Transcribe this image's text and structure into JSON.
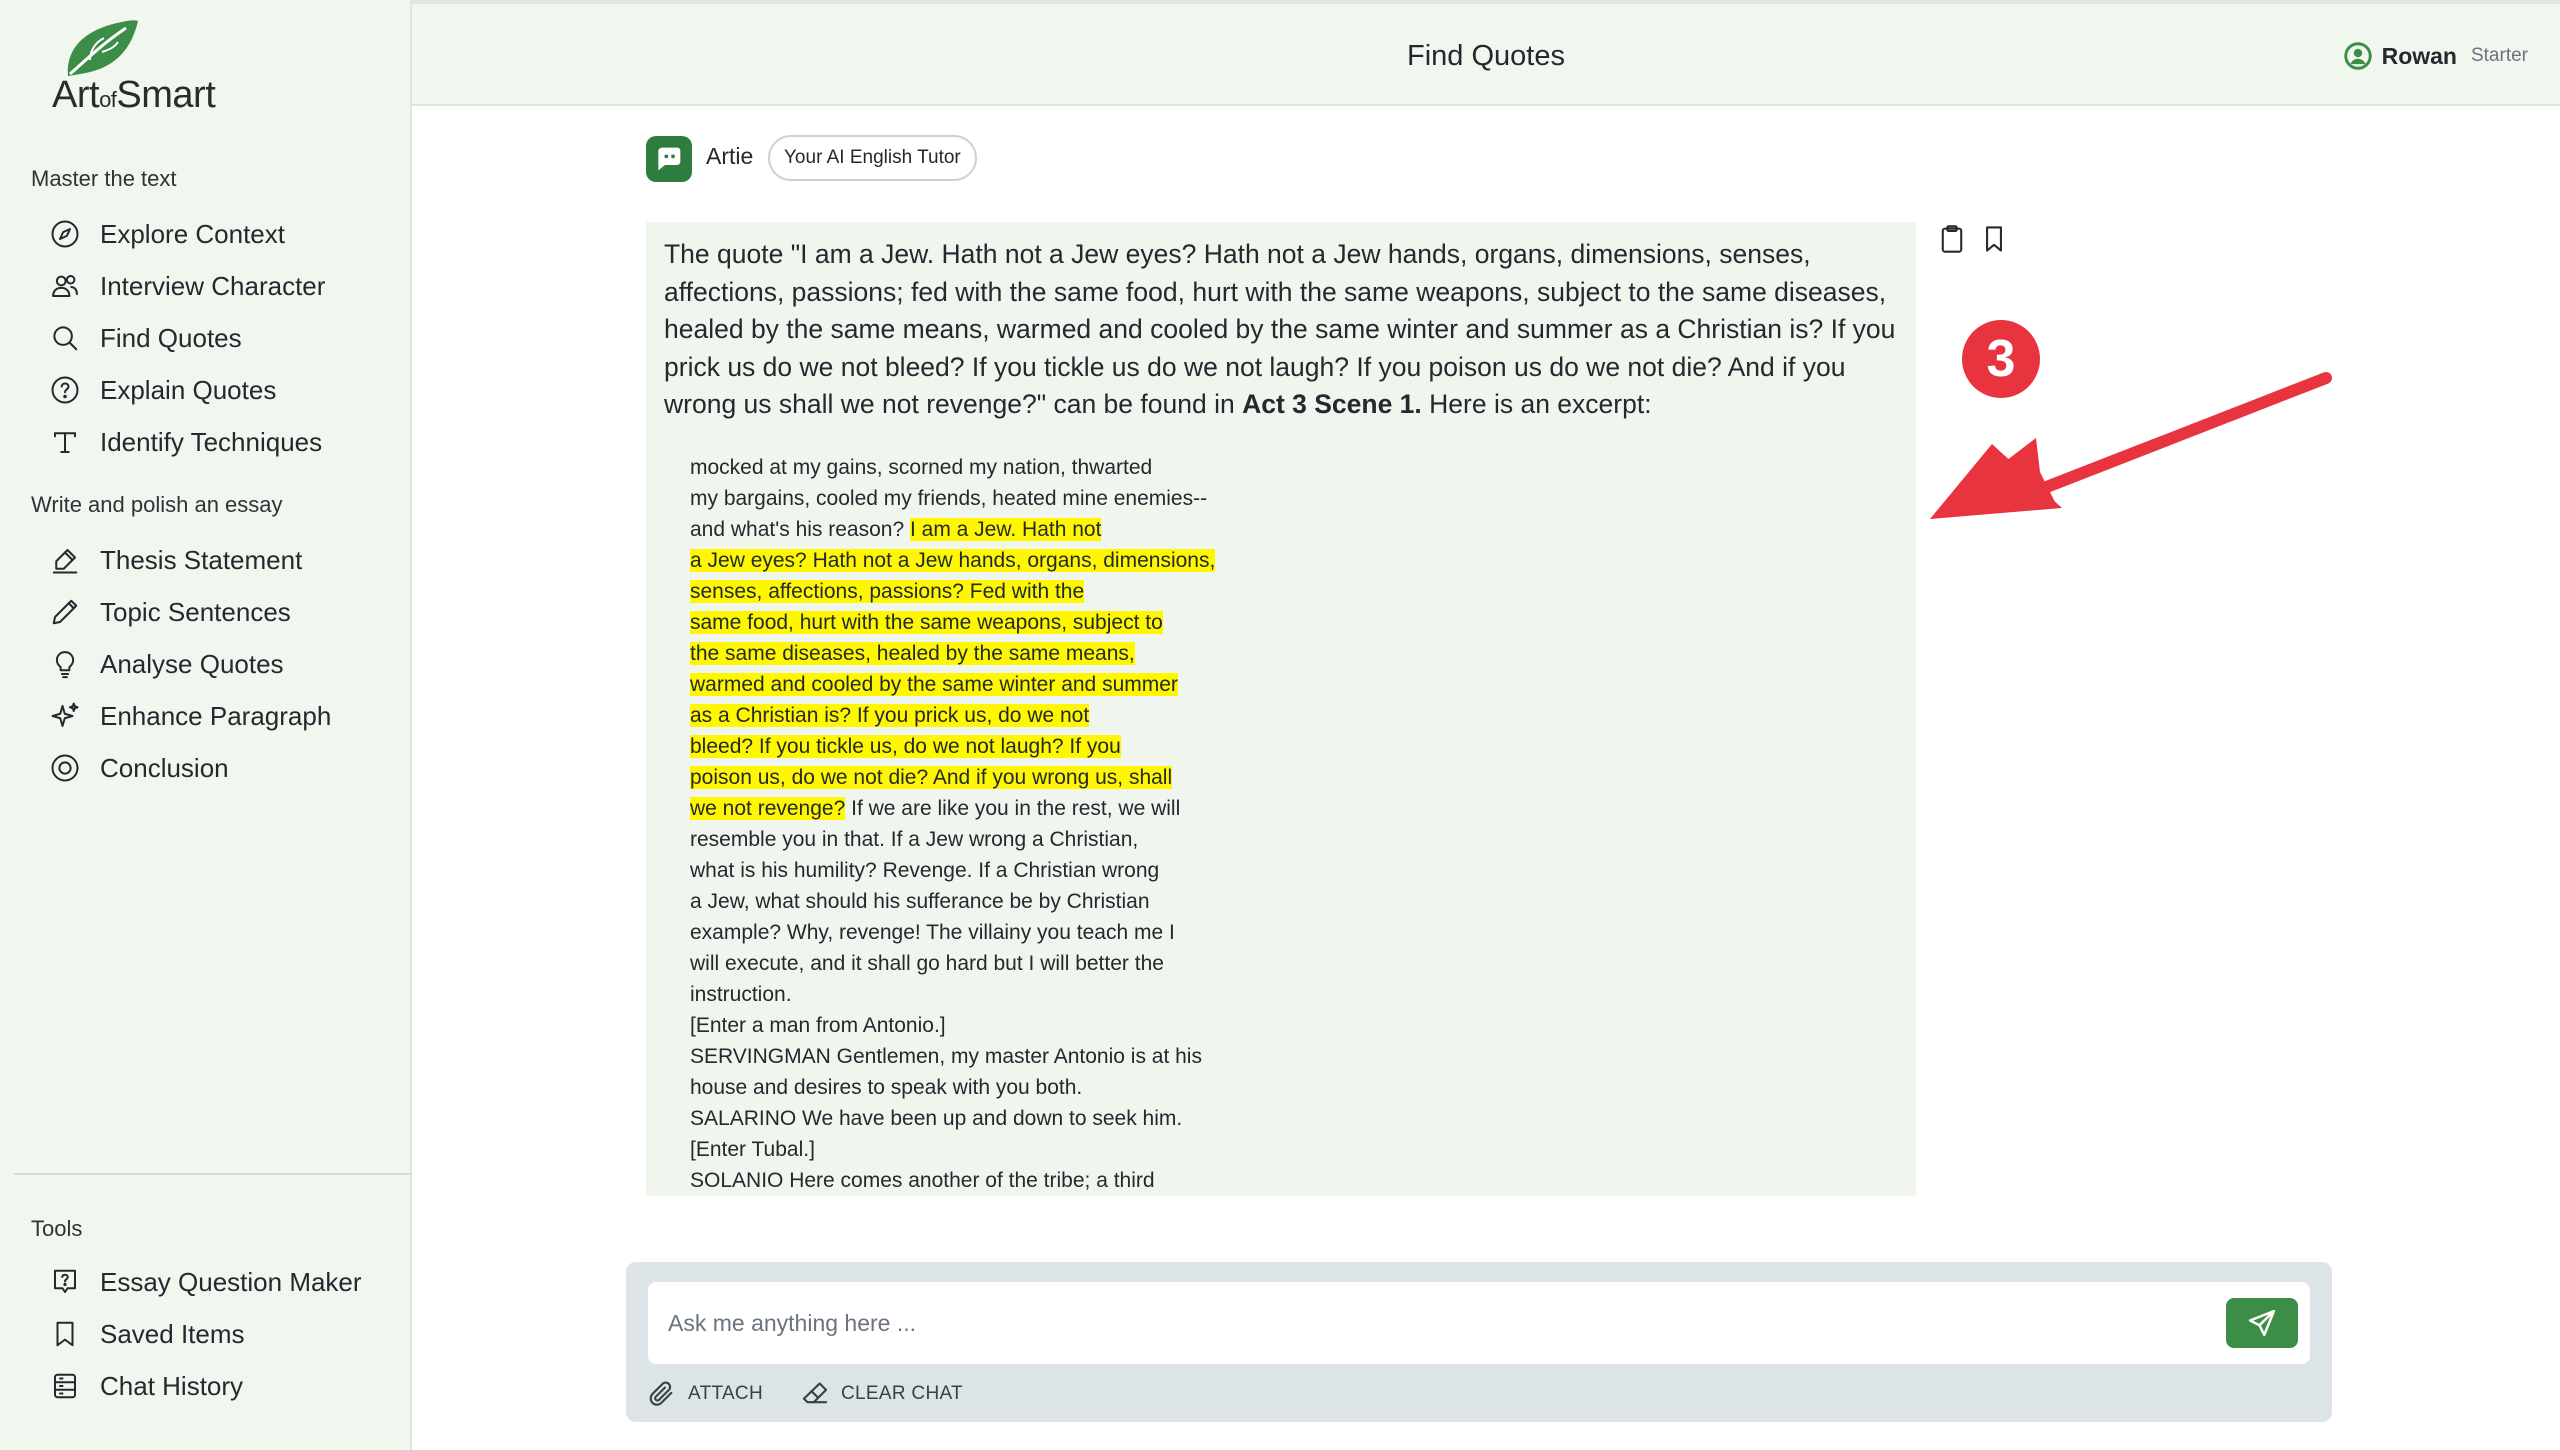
{
  "brand": {
    "name_part1": "Art",
    "name_part2": "of",
    "name_part3": "Smart",
    "color": "#3c8d47"
  },
  "sidebar": {
    "section1_label": "Master the text",
    "section1_items": [
      {
        "label": "Explore Context",
        "icon": "compass-icon"
      },
      {
        "label": "Interview Character",
        "icon": "users-icon"
      },
      {
        "label": "Find Quotes",
        "icon": "search-icon"
      },
      {
        "label": "Explain Quotes",
        "icon": "help-circle-icon"
      },
      {
        "label": "Identify Techniques",
        "icon": "type-icon"
      }
    ],
    "section2_label": "Write and polish an essay",
    "section2_items": [
      {
        "label": "Thesis Statement",
        "icon": "signature-icon"
      },
      {
        "label": "Topic Sentences",
        "icon": "pencil-icon"
      },
      {
        "label": "Analyse Quotes",
        "icon": "lightbulb-icon"
      },
      {
        "label": "Enhance Paragraph",
        "icon": "sparkles-icon"
      },
      {
        "label": "Conclusion",
        "icon": "target-icon"
      }
    ],
    "tools_label": "Tools",
    "tools_items": [
      {
        "label": "Essay Question Maker",
        "icon": "question-message-icon"
      },
      {
        "label": "Saved Items",
        "icon": "bookmark-icon"
      },
      {
        "label": "Chat History",
        "icon": "database-icon"
      }
    ]
  },
  "header": {
    "title": "Find Quotes",
    "user_name": "Rowan",
    "user_plan": "Starter"
  },
  "assistant": {
    "name": "Artie",
    "tag": "Your AI English Tutor"
  },
  "message": {
    "intro_before": "The quote \"I am a Jew. Hath not a Jew eyes? Hath not a Jew hands, organs, dimensions, senses, affections, passions; fed with the same food, hurt with the same weapons, subject to the same diseases, healed by the same means, warmed and cooled by the same winter and summer as a Christian is? If you prick us do we not bleed? If you tickle us do we not laugh? If you poison us do we not die? And if you wrong us shall we not revenge?\" can be found in",
    "intro_bold": "Act 3 Scene 1.",
    "intro_after": "Here is an excerpt:",
    "excerpt_lines": [
      {
        "plain": "mocked at my gains, scorned my nation, thwarted",
        "highlight": "",
        "after": ""
      },
      {
        "plain": "my bargains, cooled my friends, heated mine enemies--",
        "highlight": "",
        "after": ""
      },
      {
        "plain": "and what's his reason? ",
        "highlight": "I am a Jew. Hath not",
        "after": ""
      },
      {
        "plain": "",
        "highlight": "a Jew eyes? Hath not a Jew hands, organs, dimensions,",
        "after": ""
      },
      {
        "plain": "",
        "highlight": "senses, affections, passions? Fed with the",
        "after": ""
      },
      {
        "plain": "",
        "highlight": "same food, hurt with the same weapons, subject to",
        "after": ""
      },
      {
        "plain": "",
        "highlight": "the same diseases, healed by the same means,",
        "after": ""
      },
      {
        "plain": "",
        "highlight": "warmed and cooled by the same winter and summer",
        "after": ""
      },
      {
        "plain": "",
        "highlight": "as a Christian is? If you prick us, do we not",
        "after": ""
      },
      {
        "plain": "",
        "highlight": "bleed? If you tickle us, do we not laugh? If you",
        "after": ""
      },
      {
        "plain": "",
        "highlight": "poison us, do we not die? And if you wrong us, shall",
        "after": ""
      },
      {
        "plain": "",
        "highlight": "we not revenge?",
        "after": " If we are like you in the rest, we will"
      },
      {
        "plain": "resemble you in that. If a Jew wrong a Christian,",
        "highlight": "",
        "after": ""
      },
      {
        "plain": "what is his humility? Revenge. If a Christian wrong",
        "highlight": "",
        "after": ""
      },
      {
        "plain": "a Jew, what should his sufferance be by Christian",
        "highlight": "",
        "after": ""
      },
      {
        "plain": "example? Why, revenge! The villainy you teach me I",
        "highlight": "",
        "after": ""
      },
      {
        "plain": "will execute, and it shall go hard but I will better the",
        "highlight": "",
        "after": ""
      },
      {
        "plain": "instruction.",
        "highlight": "",
        "after": ""
      },
      {
        "plain": "[Enter a man from Antonio.]",
        "highlight": "",
        "after": ""
      },
      {
        "plain": "SERVINGMAN Gentlemen, my master Antonio is at his",
        "highlight": "",
        "after": ""
      },
      {
        "plain": "house and desires to speak with you both.",
        "highlight": "",
        "after": ""
      },
      {
        "plain": "SALARINO We have been up and down to seek him.",
        "highlight": "",
        "after": ""
      },
      {
        "plain": "[Enter Tubal.]",
        "highlight": "",
        "after": ""
      },
      {
        "plain": "SOLANIO Here comes another of the tribe; a third",
        "highlight": "",
        "after": ""
      }
    ],
    "highlight_color": "#fff700"
  },
  "annotation": {
    "step_number": "3",
    "color": "#e8343f"
  },
  "composer": {
    "placeholder": "Ask me anything here ...",
    "attach_label": "ATTACH",
    "clear_label": "CLEAR CHAT"
  }
}
